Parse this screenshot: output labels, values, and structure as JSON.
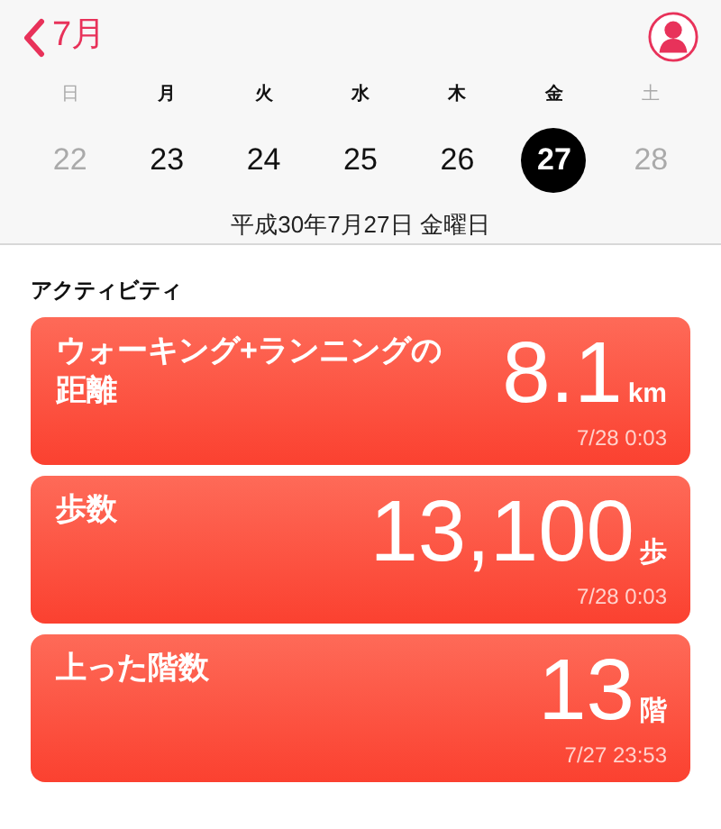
{
  "header": {
    "back_label": "7月"
  },
  "week": [
    {
      "weekday": "日",
      "date": "22",
      "dimmed": true,
      "selected": false
    },
    {
      "weekday": "月",
      "date": "23",
      "dimmed": false,
      "selected": false
    },
    {
      "weekday": "火",
      "date": "24",
      "dimmed": false,
      "selected": false
    },
    {
      "weekday": "水",
      "date": "25",
      "dimmed": false,
      "selected": false
    },
    {
      "weekday": "木",
      "date": "26",
      "dimmed": false,
      "selected": false
    },
    {
      "weekday": "金",
      "date": "27",
      "dimmed": false,
      "selected": true
    },
    {
      "weekday": "土",
      "date": "28",
      "dimmed": true,
      "selected": false
    }
  ],
  "selected_date": "平成30年7月27日 金曜日",
  "section_title": "アクティビティ",
  "cards": [
    {
      "title": "ウォーキング+ランニングの距離",
      "value": "8.1",
      "unit": "km",
      "time": "7/28 0:03"
    },
    {
      "title": "歩数",
      "value": "13,100",
      "unit": "歩",
      "time": "7/28 0:03"
    },
    {
      "title": "上った階数",
      "value": "13",
      "unit": "階",
      "time": "7/27 23:53"
    }
  ]
}
